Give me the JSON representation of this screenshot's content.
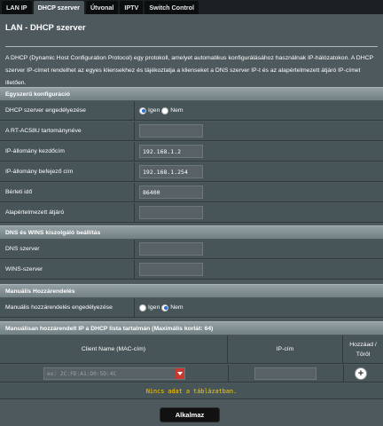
{
  "tabs": [
    "LAN IP",
    "DHCP szerver",
    "Útvonal",
    "IPTV",
    "Switch Control"
  ],
  "page": {
    "title": "LAN - DHCP szerver",
    "description": "A DHCP (Dynamic Host Configuration Protocol) egy protokoll, amelyet automatikus konfigurálásához használnak IP-hálózatokon. A DHCP szerver IP-címet rendelhet az egyes kliensekhez és tájékoztatja a klienseket a DNS szerver IP-t és az alapértelmezett átjáró IP-címet illetően."
  },
  "basic": {
    "header": "Egyszerű konfiguráció",
    "enable_label": "DHCP szerver engedélyezése",
    "yes": "Igen",
    "no": "Nem",
    "enable_value": "yes",
    "domain_label": "A RT-AC58U tartománynéve",
    "domain_value": "",
    "start_label": "IP-állomány kezdőcím",
    "start_value": "192.168.1.2",
    "end_label": "IP-állomány befejező cím",
    "end_value": "192.168.1.254",
    "lease_label": "Bérleti idő",
    "lease_value": "86400",
    "gateway_label": "Alapértelmezett átjáró",
    "gateway_value": ""
  },
  "dns": {
    "header": "DNS és WINS kiszolgáló beállítás",
    "dns_label": "DNS szerver",
    "dns_value": "",
    "wins_label": "WINS-szerver",
    "wins_value": ""
  },
  "manual": {
    "header": "Manuális Hozzárendelés",
    "enable_label": "Manuális hozzárendelés engedélyezése",
    "yes": "Igen",
    "no": "Nem",
    "enable_value": "no"
  },
  "list": {
    "header": "Manuálisan hozzárendelt IP a DHCP lista tartalmán (Maximális korlát: 64)",
    "col_client": "Client Name (MAC-cím)",
    "col_ip": "IP-cím",
    "col_action_1": "Hozzáad /",
    "col_action_2": "Töröl",
    "mac_placeholder": "ex: 2C:FD:A1:D0:5D:4C",
    "empty_text": "Nincs adat a táblázatban."
  },
  "apply_label": "Alkalmaz",
  "colors": {
    "accent": "#2a6fd6",
    "warning": "#ffcc00",
    "dropdown": "#c7382e"
  }
}
